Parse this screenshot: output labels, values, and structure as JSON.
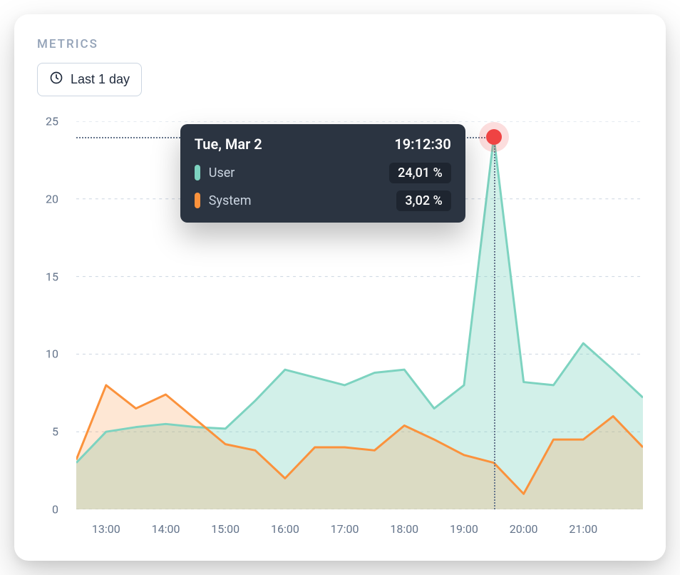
{
  "header": {
    "label": "METRICS"
  },
  "range_button": {
    "label": "Last 1 day"
  },
  "tooltip": {
    "date": "Tue, Mar 2",
    "time": "19:12:30",
    "rows": [
      {
        "name": "User",
        "value": "24,01 %",
        "color": "#7dd3c0"
      },
      {
        "name": "System",
        "value": "3,02 %",
        "color": "#fb923c"
      }
    ]
  },
  "chart_data": {
    "type": "area",
    "title": "",
    "xlabel": "",
    "ylabel": "",
    "ylim": [
      0,
      25
    ],
    "y_ticks": [
      0,
      5,
      10,
      15,
      20,
      25
    ],
    "x_tick_labels": [
      "13:00",
      "14:00",
      "15:00",
      "16:00",
      "17:00",
      "18:00",
      "19:00",
      "20:00",
      "21:00"
    ],
    "x": [
      "12:30",
      "13:00",
      "13:30",
      "14:00",
      "14:30",
      "15:00",
      "15:30",
      "16:00",
      "16:30",
      "17:00",
      "17:30",
      "18:00",
      "18:30",
      "19:00",
      "19:12",
      "19:30",
      "20:00",
      "20:30",
      "21:00",
      "21:30"
    ],
    "series": [
      {
        "name": "User",
        "color": "#7dd3c0",
        "fill": "rgba(125,211,192,0.35)",
        "values": [
          3.0,
          5.0,
          5.3,
          5.5,
          5.3,
          5.2,
          7.0,
          9.0,
          8.5,
          8.0,
          8.8,
          9.0,
          6.5,
          8.0,
          24.0,
          8.2,
          8.0,
          10.7,
          9.0,
          7.2
        ]
      },
      {
        "name": "System",
        "color": "#fb923c",
        "fill": "rgba(251,146,60,0.22)",
        "values": [
          3.2,
          8.0,
          6.5,
          7.4,
          5.8,
          4.2,
          3.8,
          2.0,
          4.0,
          4.0,
          3.8,
          5.4,
          4.5,
          3.5,
          3.0,
          1.0,
          4.5,
          4.5,
          6.0,
          4.0
        ]
      }
    ],
    "highlight_index": 14,
    "legend_position": "tooltip",
    "grid": true
  }
}
